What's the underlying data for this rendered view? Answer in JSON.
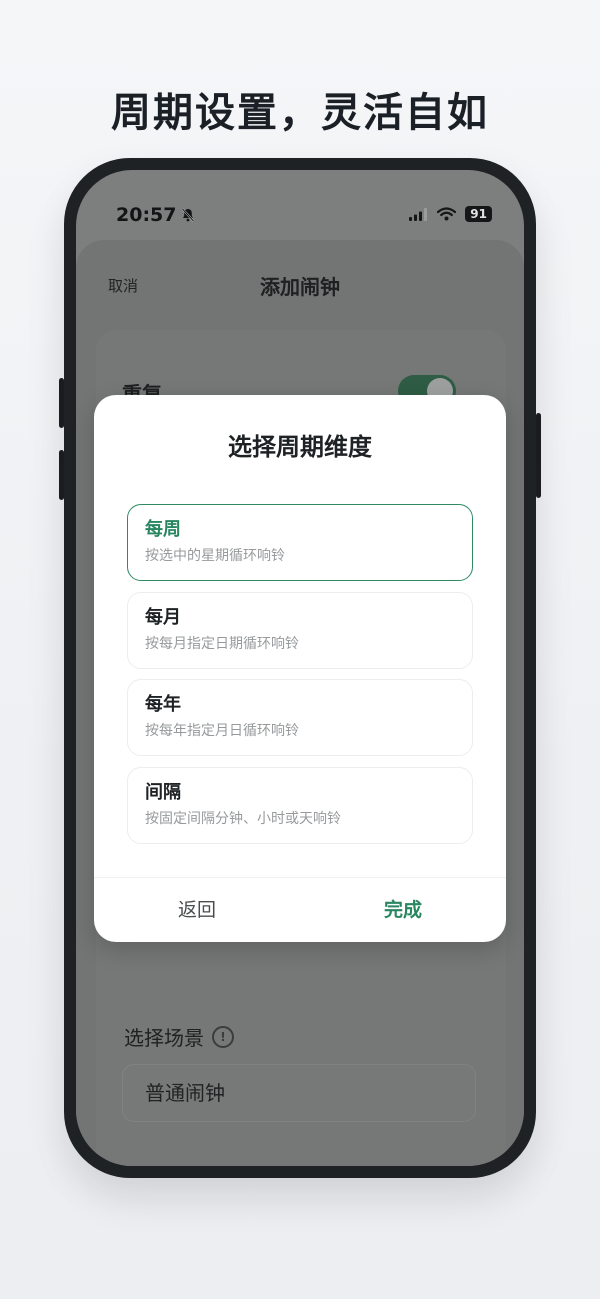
{
  "headline": "周期设置，灵活自如",
  "status_bar": {
    "time": "20:57",
    "battery": "91"
  },
  "sheet": {
    "cancel_label": "取消",
    "title": "添加闹钟",
    "repeat_label": "重复",
    "repeat_enabled": true,
    "scene_label": "选择场景",
    "scene_value": "普通闹钟"
  },
  "modal": {
    "title": "选择周期维度",
    "options": [
      {
        "title": "每周",
        "desc": "按选中的星期循环响铃",
        "selected": true
      },
      {
        "title": "每月",
        "desc": "按每月指定日期循环响铃",
        "selected": false
      },
      {
        "title": "每年",
        "desc": "按每年指定月日循环响铃",
        "selected": false
      },
      {
        "title": "间隔",
        "desc": "按固定间隔分钟、小时或天响铃",
        "selected": false
      }
    ],
    "back_label": "返回",
    "done_label": "完成"
  },
  "colors": {
    "accent": "#2a8660",
    "headline": "#1b2027"
  }
}
